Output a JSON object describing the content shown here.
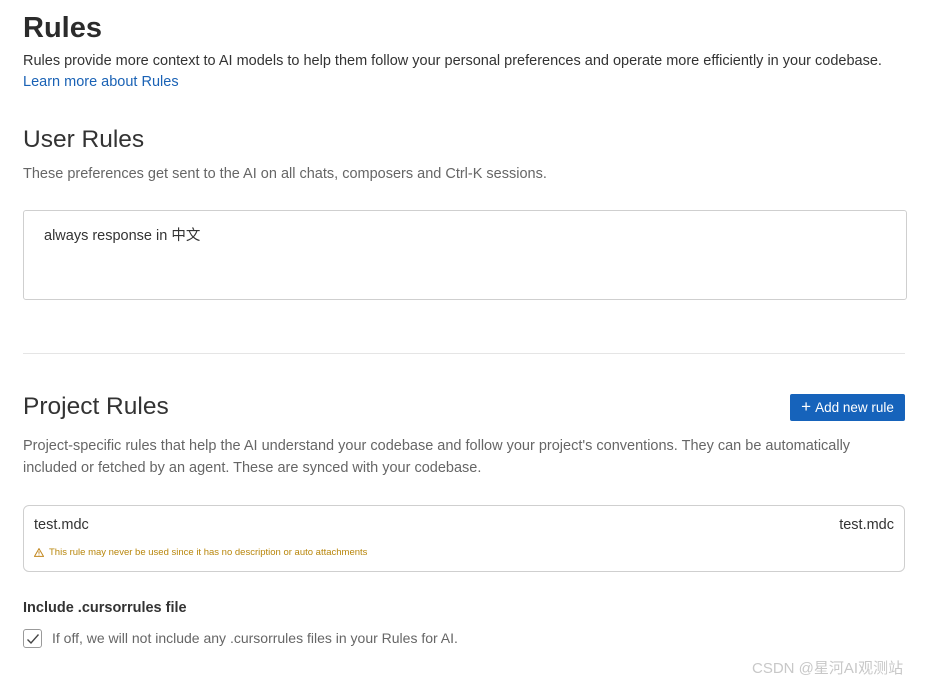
{
  "header": {
    "title": "Rules",
    "intro": "Rules provide more context to AI models to help them follow your personal preferences and operate more efficiently in your codebase.",
    "learn_more_link": "Learn more about Rules"
  },
  "user_rules": {
    "title": "User Rules",
    "description": "These preferences get sent to the AI on all chats, composers and Ctrl-K sessions.",
    "value": "always response in 中文"
  },
  "project_rules": {
    "title": "Project Rules",
    "add_button_label": "Add new rule",
    "description": "Project-specific rules that help the AI understand your codebase and follow your project's conventions. They can be automatically included or fetched by an agent. These are synced with your codebase.",
    "rules": [
      {
        "name": "test.mdc",
        "file": "test.mdc",
        "warning": "This rule may never be used since it has no description or auto attachments"
      }
    ]
  },
  "cursorrules": {
    "title": "Include .cursorrules file",
    "checked": true,
    "description": "If off, we will not include any .cursorrules files in your Rules for AI."
  },
  "watermark": "CSDN @星河AI观测站",
  "colors": {
    "accent": "#1663bb",
    "link": "#1a62b5",
    "warning": "#b8860b"
  }
}
